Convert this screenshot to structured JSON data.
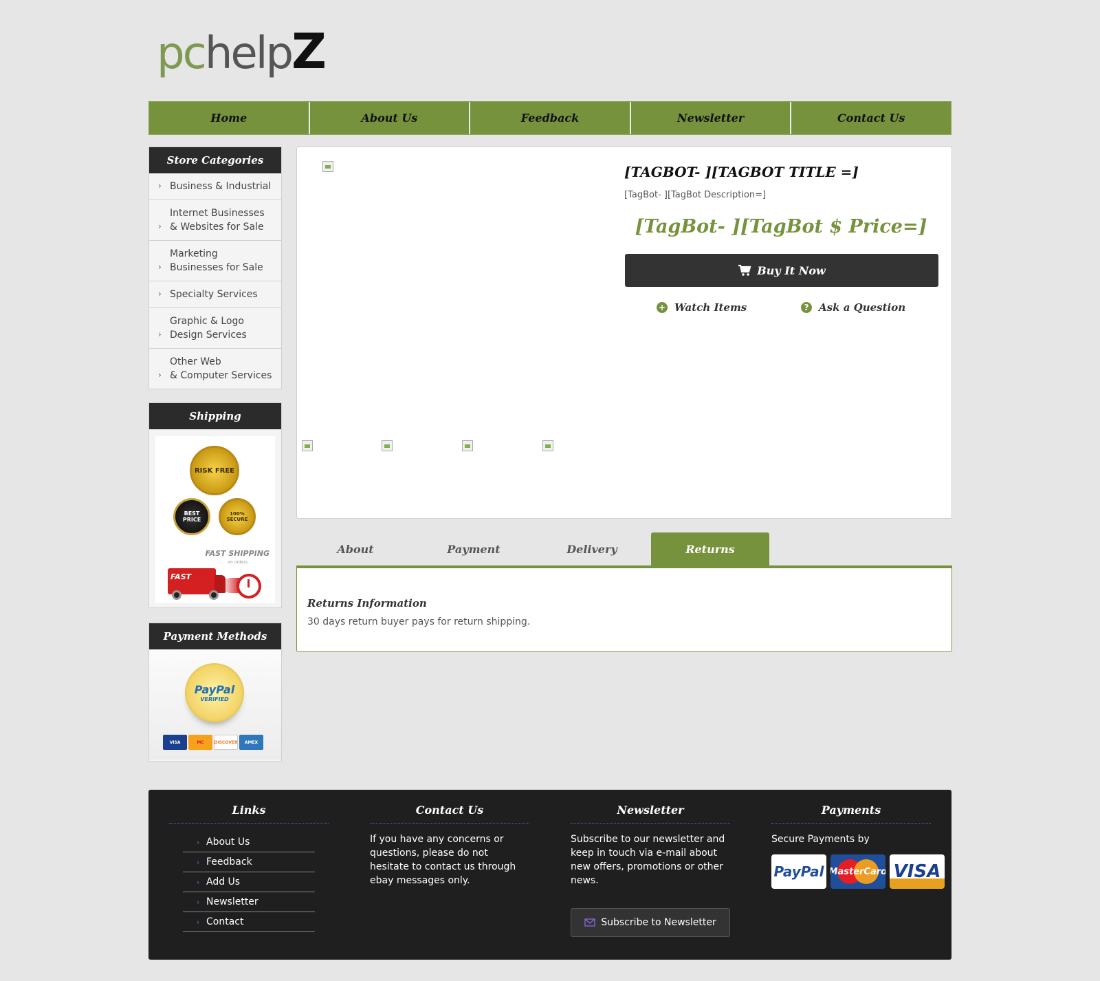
{
  "logo": {
    "pc": "pc",
    "help": "help",
    "z": "Z"
  },
  "nav": [
    "Home",
    "About Us",
    "Feedback",
    "Newsletter",
    "Contact Us"
  ],
  "sidebar": {
    "categories_title": "Store Categories",
    "categories": [
      "Business & Industrial",
      "Internet Businesses\n& Websites for Sale",
      "Marketing\nBusinesses for Sale",
      "Specialty Services",
      "Graphic & Logo\nDesign Services",
      "Other Web\n& Computer Services"
    ],
    "shipping_title": "Shipping",
    "shipping_badges": {
      "risk_free": "RISK FREE",
      "best_price": "BEST PRICE",
      "secure": "100% SECURE",
      "fast_shipping": "FAST SHIPPING",
      "fast_sub": "on orders",
      "truck_label": "FAST"
    },
    "payment_title": "Payment Methods",
    "paypal_seal": {
      "name": "PayPal",
      "verified": "VERIFIED"
    },
    "mini_cards": [
      "VISA",
      "MC",
      "DISCOVER",
      "AMEX"
    ]
  },
  "product": {
    "title": "[TAGBOT- ][TAGBOT TITLE =]",
    "description": "[TagBot- ][TagBot Description=]",
    "price": "[TagBot- ][TagBot $ Price=]",
    "buy_label": "Buy It Now",
    "watch_label": "Watch Items",
    "ask_label": "Ask a Question"
  },
  "tabs": {
    "items": [
      "About",
      "Payment",
      "Delivery",
      "Returns"
    ],
    "active": "Returns",
    "panel_title": "Returns Information",
    "panel_text": "30 days return buyer pays for return shipping."
  },
  "footer": {
    "links_title": "Links",
    "links": [
      "About Us",
      "Feedback",
      "Add Us",
      "Newsletter",
      "Contact"
    ],
    "contact_title": "Contact Us",
    "contact_text": "If you have any concerns or questions, please do not hesitate to contact us through ebay messages only.",
    "newsletter_title": "Newsletter",
    "newsletter_text": "Subscribe to our newsletter and keep in touch via e-mail about new offers, promotions or other news.",
    "subscribe_label": "Subscribe to Newsletter",
    "payments_title": "Payments",
    "payments_text": "Secure Payments by",
    "cards": {
      "paypal": "PayPal",
      "mastercard": "MasterCard",
      "visa": "VISA"
    }
  },
  "colors": {
    "accent": "#76923c",
    "dark": "#2b2b2b",
    "background": "#e6e6e6",
    "footer": "#1f1f1f"
  }
}
